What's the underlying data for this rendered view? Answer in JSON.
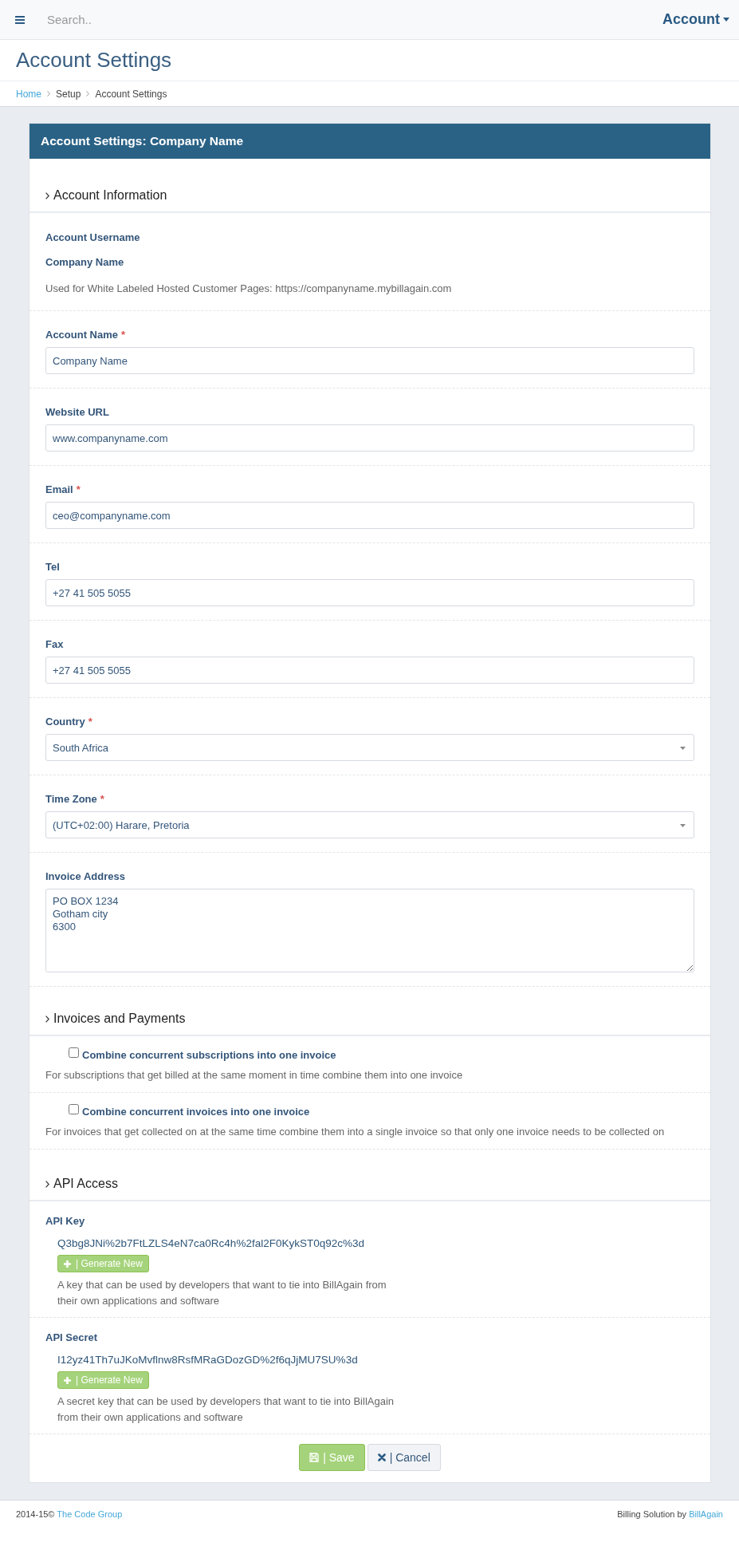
{
  "topbar": {
    "search": {
      "placeholder": "Search.."
    },
    "account_menu": {
      "label": "Account"
    }
  },
  "page_title": "Account Settings",
  "breadcrumb": [
    {
      "label": "Home",
      "kind": "link"
    },
    {
      "label": "Setup",
      "kind": "text"
    },
    {
      "label": "Account Settings",
      "kind": "text"
    }
  ],
  "card": {
    "title": "Account Settings: Company Name"
  },
  "required_mark": "*",
  "account_information": {
    "heading": "Account Information",
    "info": [
      {
        "kind": "label",
        "text": "Account Username"
      },
      {
        "kind": "label",
        "text": "Company Name"
      },
      {
        "kind": "note",
        "text": "Used for White Labeled Hosted Customer Pages: https://companyname.mybillagain.com"
      }
    ],
    "fields": [
      {
        "kind": "text",
        "label": "Account Name",
        "required": true,
        "value": "Company Name"
      },
      {
        "kind": "text",
        "label": "Website URL",
        "required": false,
        "value": "www.companyname.com"
      },
      {
        "kind": "text",
        "label": "Email",
        "required": true,
        "value": "ceo@companyname.com"
      },
      {
        "kind": "text",
        "label": "Tel",
        "required": false,
        "value": "+27 41 505 5055"
      },
      {
        "kind": "text",
        "label": "Fax",
        "required": false,
        "value": "+27 41 505 5055"
      },
      {
        "kind": "select",
        "label": "Country",
        "required": true,
        "value": "South Africa"
      },
      {
        "kind": "select",
        "label": "Time Zone",
        "required": true,
        "value": "(UTC+02:00) Harare, Pretoria"
      },
      {
        "kind": "textarea",
        "label": "Invoice Address",
        "required": false,
        "value": "PO BOX 1234\nGotham city\n6300"
      }
    ]
  },
  "invoices_and_payments": {
    "heading": "Invoices and Payments",
    "options": [
      {
        "label": "Combine concurrent subscriptions into one invoice",
        "checked": false,
        "description": "For subscriptions that get billed at the same moment in time combine them into one invoice"
      },
      {
        "label": "Combine concurrent invoices into one invoice",
        "checked": false,
        "description": "For invoices that get collected on at the same time combine them into a single invoice so that only one invoice needs to be collected on"
      }
    ]
  },
  "api_access": {
    "heading": "API Access",
    "keys": [
      {
        "label": "API Key",
        "value": "Q3bg8JNi%2b7FtLZLS4eN7ca0Rc4h%2fal2F0KykST0q92c%3d",
        "button": "| Generate New",
        "description": "A key that can be used by developers that want to tie into BillAgain from their own applications and software"
      },
      {
        "label": "API Secret",
        "value": "I12yz41Th7uJKoMvflnw8RsfMRaGDozGD%2f6qJjMU7SU%3d",
        "button": "| Generate New",
        "description": "A secret key that can be used by developers that want to tie into BillAgain from their own applications and software"
      }
    ]
  },
  "actions": [
    {
      "kind": "save",
      "label": "| Save"
    },
    {
      "kind": "cancel",
      "label": "| Cancel"
    }
  ],
  "footer": {
    "copyright": "2014-15©",
    "company_link": "The Code Group",
    "credit": "Billing Solution by",
    "brand_link": "BillAgain"
  }
}
